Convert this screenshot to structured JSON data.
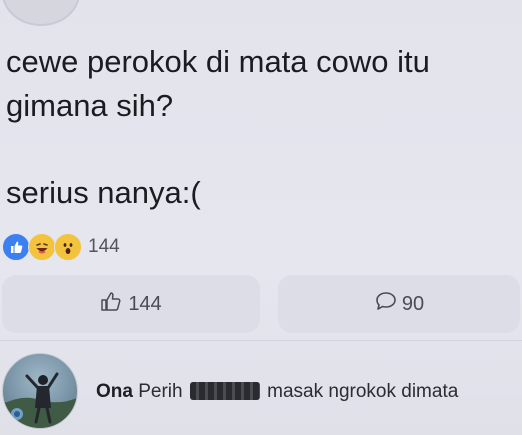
{
  "post": {
    "lines": [
      "cewe perokok di mata cowo itu",
      "gimana sih?",
      "serius nanya:("
    ]
  },
  "reactions": {
    "icons": [
      "like-icon",
      "haha-icon",
      "wow-icon"
    ],
    "count": "144"
  },
  "actions": {
    "like_count": "144",
    "comment_count": "90"
  },
  "comment": {
    "author": "Ona",
    "text_before": "Perih",
    "text_after": "masak ngrokok dimata"
  },
  "colors": {
    "like_blue": "#3b7ff0",
    "emoji_yellow": "#f4c33d",
    "background": "#e6e6ef"
  }
}
